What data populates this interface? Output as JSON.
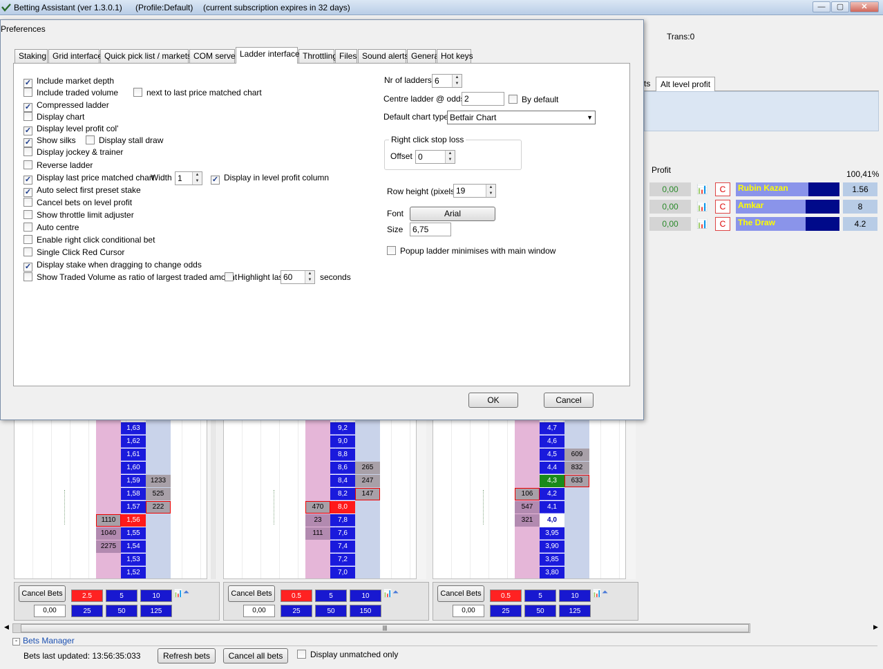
{
  "window": {
    "title": "Betting Assistant (ver 1.3.0.1)",
    "profile": "(Profile:Default)",
    "subscription": "(current subscription expires in 32 days)",
    "min": "—",
    "max": "▢",
    "close": "✕"
  },
  "background": {
    "trans": "Trans:0",
    "alt_tab_prefix": "ts",
    "alt_tab": "Alt level profit",
    "profit_label": "Profit",
    "percent": "100,41%",
    "runners": [
      {
        "profit": "0,00",
        "c": "C",
        "name": "Rubin Kazan",
        "odds": "1.56",
        "bar": 0.3
      },
      {
        "profit": "0,00",
        "c": "C",
        "name": "Amkar",
        "odds": "8",
        "bar": 0.33
      },
      {
        "profit": "0,00",
        "c": "C",
        "name": "The Draw",
        "odds": "4.2",
        "bar": 0.33
      }
    ]
  },
  "ladders": [
    {
      "prices": [
        "1,63",
        "1,62",
        "1,61",
        "1,60",
        "1,59",
        "1,58",
        "1,57",
        "1,56",
        "1,55",
        "1,54",
        "1,53",
        "1,52"
      ],
      "lay": [
        "",
        "",
        "",
        "",
        "1233",
        "525",
        "222",
        "",
        "",
        "",
        "",
        ""
      ],
      "back": [
        "",
        "",
        "",
        "",
        "",
        "",
        "",
        "1110",
        "1040",
        "2275",
        "",
        ""
      ],
      "cancel": "Cancel Bets",
      "stakes_top": [
        "2.5",
        "5",
        "10"
      ],
      "stakes_bottom": [
        "25",
        "50",
        "125"
      ],
      "profit": "0,00"
    },
    {
      "prices": [
        "9,2",
        "9,0",
        "8,8",
        "8,6",
        "8,4",
        "8,2",
        "8,0",
        "7,8",
        "7,6",
        "7,4",
        "7,2",
        "7,0"
      ],
      "lay": [
        "",
        "",
        "",
        "265",
        "247",
        "147",
        "",
        "",
        "",
        "",
        "",
        ""
      ],
      "back": [
        "",
        "",
        "",
        "",
        "",
        "",
        "470",
        "23",
        "111",
        "",
        "",
        ""
      ],
      "cancel": "Cancel Bets",
      "stakes_top": [
        "0.5",
        "5",
        "10"
      ],
      "stakes_bottom": [
        "25",
        "50",
        "150"
      ],
      "profit": "0,00"
    },
    {
      "prices": [
        "4,7",
        "4,6",
        "4,5",
        "4,4",
        "4,3",
        "4,2",
        "4,1",
        "4,0",
        "3,95",
        "3,90",
        "3,85",
        "3,80"
      ],
      "lay": [
        "",
        "",
        "609",
        "832",
        "633",
        "",
        "",
        "",
        "",
        "",
        "",
        ""
      ],
      "back": [
        "",
        "",
        "",
        "",
        "",
        "106",
        "547",
        "321",
        "",
        "",
        "",
        ""
      ],
      "cancel": "Cancel Bets",
      "stakes_top": [
        "0.5",
        "5",
        "10"
      ],
      "stakes_bottom": [
        "25",
        "50",
        "125"
      ],
      "profit": "0,00"
    }
  ],
  "bets_manager": {
    "title": "Bets Manager",
    "toggle": "-",
    "updated": "Bets last updated: 13:56:35:033",
    "refresh": "Refresh bets",
    "cancel_all": "Cancel all bets",
    "display_unmatched": "Display unmatched only"
  },
  "dialog": {
    "title": "Preferences",
    "tabs": [
      "Staking",
      "Grid interface",
      "Quick pick list / markets",
      "COM server",
      "Ladder interface",
      "Throttling",
      "Files",
      "Sound alerts",
      "General",
      "Hot keys"
    ],
    "active_tab": "Ladder interface",
    "checkboxes": [
      {
        "label": "Include market depth",
        "checked": true
      },
      {
        "label": "Include traded volume",
        "checked": false
      },
      {
        "label": "Compressed ladder",
        "checked": true
      },
      {
        "label": "Display chart",
        "checked": false
      },
      {
        "label": "Display level profit col'",
        "checked": true
      },
      {
        "label": "Show silks",
        "checked": true
      },
      {
        "label": "Display jockey & trainer",
        "checked": false
      },
      {
        "label": "Reverse ladder",
        "checked": false
      },
      {
        "label": "Display last price matched chart",
        "checked": true
      },
      {
        "label": "Auto select first preset stake",
        "checked": true
      },
      {
        "label": "Cancel bets on level profit",
        "checked": false
      },
      {
        "label": "Show throttle limit adjuster",
        "checked": false
      },
      {
        "label": "Auto centre",
        "checked": false
      },
      {
        "label": "Enable right click conditional bet",
        "checked": false
      },
      {
        "label": "Single Click Red Cursor",
        "checked": false
      },
      {
        "label": "Display stake when dragging to change odds",
        "checked": true
      },
      {
        "label": "Show Traded Volume as ratio of largest traded amount",
        "checked": false
      }
    ],
    "next_to_last": {
      "label": "next to last price matched chart",
      "checked": false
    },
    "display_stall_draw": {
      "label": "Display stall draw",
      "checked": false
    },
    "width_label": "Width",
    "width_value": "1",
    "display_in_level": {
      "label": "Display in level profit column",
      "checked": true
    },
    "highlight_last": {
      "label": "Highlight last",
      "checked": false
    },
    "highlight_value": "60",
    "seconds_label": "seconds",
    "nr_ladders_label": "Nr of ladders",
    "nr_ladders": "6",
    "centre_label": "Centre ladder @ odds",
    "centre_value": "2",
    "by_default": {
      "label": "By default",
      "checked": false
    },
    "chart_type_label": "Default chart type",
    "chart_type": "Betfair Chart",
    "stop_loss_group": "Right click stop loss",
    "offset_label": "Offset",
    "offset_value": "0",
    "row_height_label": "Row height (pixels)",
    "row_height": "19",
    "font_label": "Font",
    "font_button": "Arial",
    "size_label": "Size",
    "size_value": "6,75",
    "popup_min": {
      "label": "Popup ladder minimises with main window",
      "checked": false
    },
    "ok": "OK",
    "cancel": "Cancel"
  },
  "colors": {
    "back_blue": "#1a1adc",
    "lay_pink": "#e5b6d8",
    "highlight_red": "#ff1a1a",
    "runner_name": "#ffff00"
  }
}
